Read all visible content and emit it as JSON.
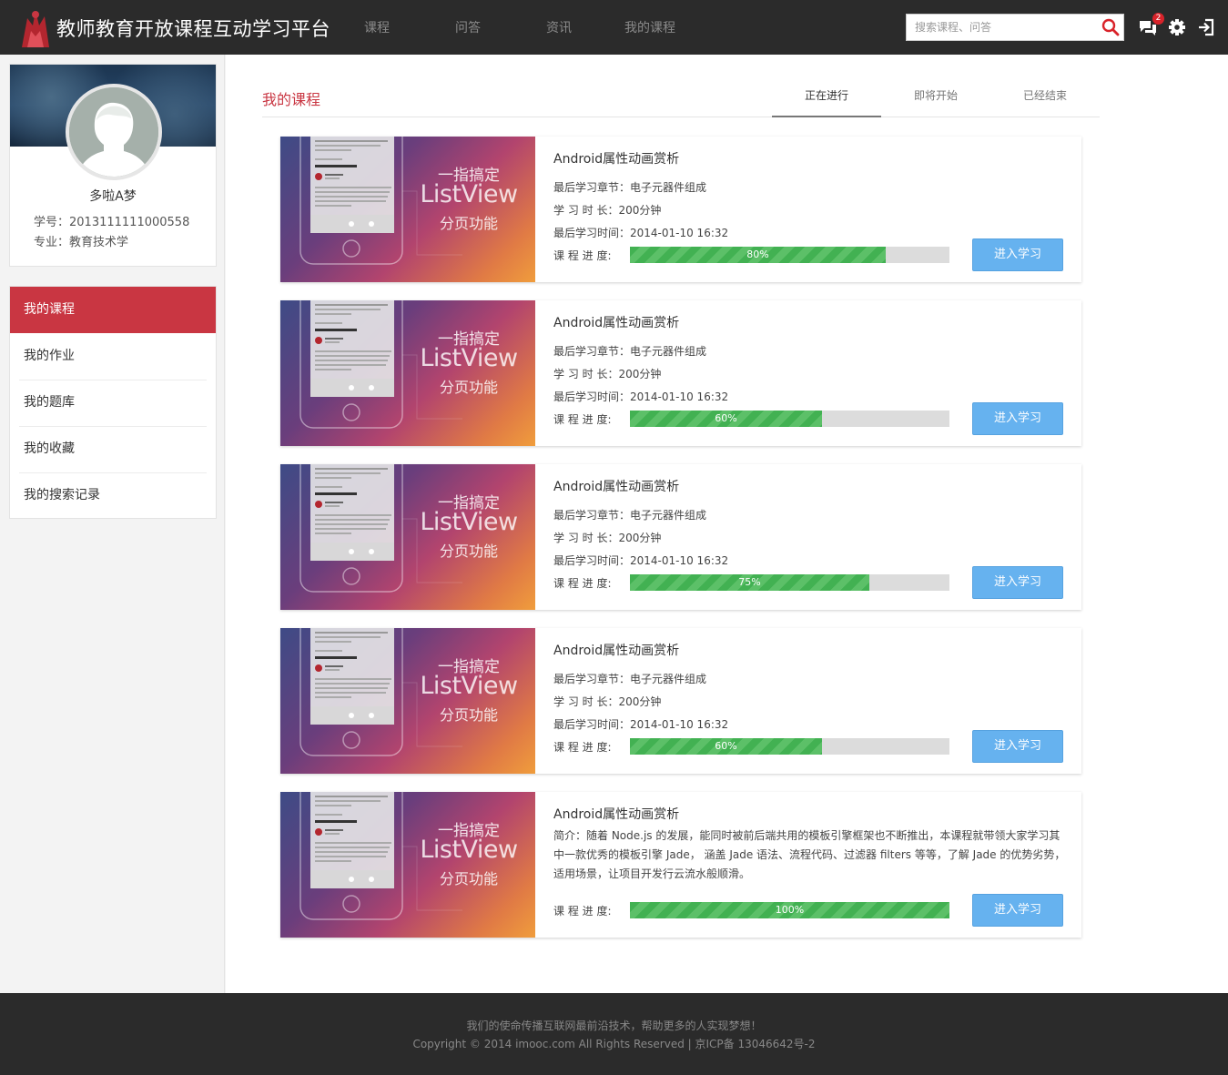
{
  "colors": {
    "brand": "#c93642",
    "header_bg": "#2b2b2b",
    "progress": "#42b152",
    "button": "#66b2ef"
  },
  "header": {
    "title": "教师教育开放课程互动学习平台",
    "nav": [
      "课程",
      "问答",
      "资讯",
      "我的课程"
    ],
    "search_placeholder": "搜索课程、问答",
    "message_count": "2",
    "icons": [
      "logo-icon",
      "search-icon",
      "message-icon",
      "gear-icon",
      "logout-icon"
    ]
  },
  "profile": {
    "name": "多啦A梦",
    "student_id": "学号：2013111111000558",
    "major": "专业：教育技术学"
  },
  "menu": [
    "我的课程",
    "我的作业",
    "我的题库",
    "我的收藏",
    "我的搜索记录"
  ],
  "main": {
    "title": "我的课程",
    "tabs": [
      "正在进行",
      "即将开始",
      "已经结束"
    ]
  },
  "thumb": {
    "line1": "一指搞定",
    "line2": "ListView",
    "line3": "分页功能"
  },
  "labels": {
    "chapter": "最后学习章节：电子元器件组成",
    "duration": "学 习 时 长：200分钟",
    "last_time": "最后学习时间：2014-01-10 16:32",
    "progress": "课 程 进 度:",
    "enter": "进入学习"
  },
  "courses": [
    {
      "title": "Android属性动画赏析",
      "progress": 80,
      "progress_text": "80%"
    },
    {
      "title": "Android属性动画赏析",
      "progress": 60,
      "progress_text": "60%"
    },
    {
      "title": "Android属性动画赏析",
      "progress": 75,
      "progress_text": "75%"
    },
    {
      "title": "Android属性动画赏析",
      "progress": 60,
      "progress_text": "60%"
    },
    {
      "title": "Android属性动画赏析",
      "progress": 100,
      "progress_text": "100%",
      "intro": "简介：随着 Node.js 的发展，能同时被前后端共用的模板引擎框架也不断推出，本课程就带领大家学习其中一款优秀的模板引擎 Jade， 涵盖 Jade 语法、流程代码、过滤器 filters 等等，了解 Jade 的优势劣势，适用场景，让项目开发行云流水般顺滑。"
    }
  ],
  "footer": {
    "mission": "我们的使命传播互联网最前沿技术，帮助更多的人实现梦想！",
    "copyright": "Copyright © 2014 imooc.com All Rights Reserved | 京ICP备 13046642号-2"
  }
}
